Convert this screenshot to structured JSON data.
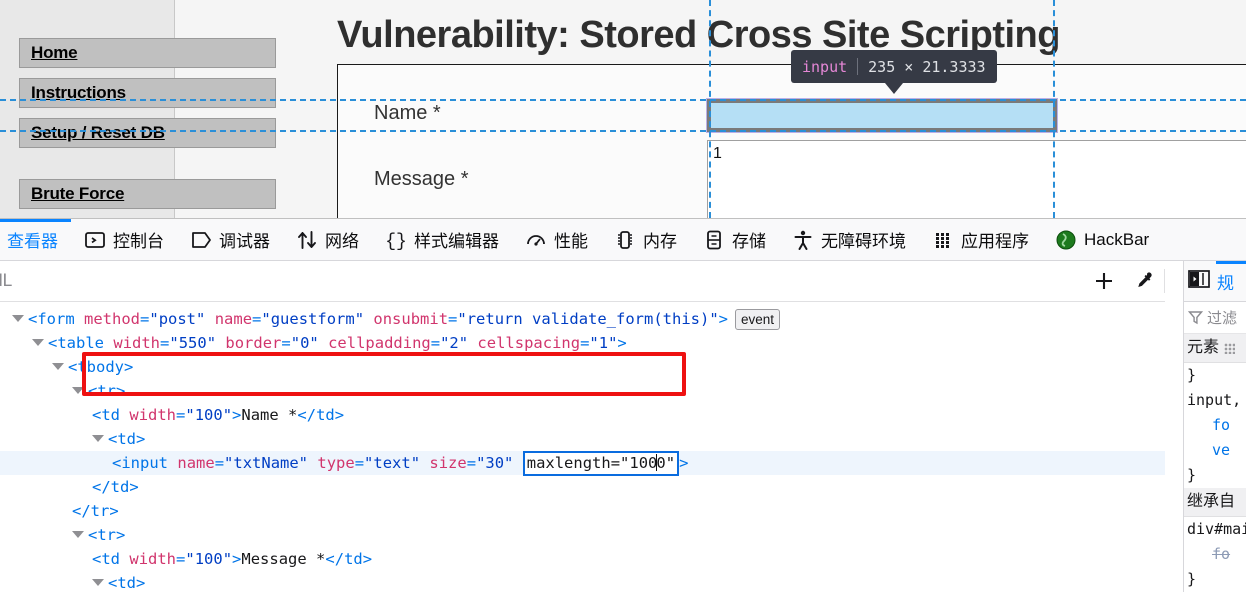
{
  "page": {
    "title": "Vulnerability: Stored Cross Site Scripting",
    "nav": [
      {
        "label": "Home"
      },
      {
        "label": "Instructions"
      },
      {
        "label": "Setup / Reset DB"
      },
      {
        "label": "Brute Force"
      }
    ],
    "form": {
      "name_label": "Name *",
      "name_value": "",
      "message_label": "Message *",
      "message_value": "1"
    },
    "inspector_tooltip": {
      "tag": "input",
      "dimensions": "235 × 21.3333"
    },
    "colors": {
      "highlight_fill": "#b5dff5",
      "guide_line": "#2a8fd8",
      "tooltip_bg": "#363a45",
      "accent": "#0a84ff",
      "red_annotation": "#ee1111"
    }
  },
  "devtools": {
    "tabs": [
      {
        "label": "查看器",
        "icon": "inspector-icon",
        "active": true
      },
      {
        "label": "控制台",
        "icon": "console-icon",
        "active": false
      },
      {
        "label": "调试器",
        "icon": "debugger-icon",
        "active": false
      },
      {
        "label": "网络",
        "icon": "network-icon",
        "active": false
      },
      {
        "label": "样式编辑器",
        "icon": "style-editor-icon",
        "active": false
      },
      {
        "label": "性能",
        "icon": "performance-icon",
        "active": false
      },
      {
        "label": "内存",
        "icon": "memory-icon",
        "active": false
      },
      {
        "label": "存储",
        "icon": "storage-icon",
        "active": false
      },
      {
        "label": "无障碍环境",
        "icon": "accessibility-icon",
        "active": false
      },
      {
        "label": "应用程序",
        "icon": "application-icon",
        "active": false
      },
      {
        "label": "HackBar",
        "icon": "hackbar-icon",
        "active": false
      }
    ],
    "subbar": {
      "breadcrumb": "ML",
      "add_node_icon": "plus-icon",
      "eyedropper_icon": "eyedropper-icon"
    },
    "markup": {
      "lines": [
        {
          "indent": 0,
          "twisty": true,
          "selected": false,
          "badge": "event",
          "tokens": [
            {
              "t": "punct",
              "s": "<"
            },
            {
              "t": "tag",
              "s": "form"
            },
            {
              "t": "txt",
              "s": " "
            },
            {
              "t": "attr",
              "s": "method"
            },
            {
              "t": "punct",
              "s": "="
            },
            {
              "t": "val",
              "s": "\"post\""
            },
            {
              "t": "txt",
              "s": " "
            },
            {
              "t": "attr",
              "s": "name"
            },
            {
              "t": "punct",
              "s": "="
            },
            {
              "t": "val",
              "s": "\"guestform\""
            },
            {
              "t": "txt",
              "s": " "
            },
            {
              "t": "attr",
              "s": "onsubmit"
            },
            {
              "t": "punct",
              "s": "="
            },
            {
              "t": "val",
              "s": "\"return validate_form(this)\""
            },
            {
              "t": "punct",
              "s": ">"
            }
          ]
        },
        {
          "indent": 1,
          "twisty": true,
          "selected": false,
          "badge": null,
          "tokens": [
            {
              "t": "punct",
              "s": "<"
            },
            {
              "t": "tag",
              "s": "table"
            },
            {
              "t": "txt",
              "s": " "
            },
            {
              "t": "attr",
              "s": "width"
            },
            {
              "t": "punct",
              "s": "="
            },
            {
              "t": "val",
              "s": "\"550\""
            },
            {
              "t": "txt",
              "s": " "
            },
            {
              "t": "attr",
              "s": "border"
            },
            {
              "t": "punct",
              "s": "="
            },
            {
              "t": "val",
              "s": "\"0\""
            },
            {
              "t": "txt",
              "s": " "
            },
            {
              "t": "attr",
              "s": "cellpadding"
            },
            {
              "t": "punct",
              "s": "="
            },
            {
              "t": "val",
              "s": "\"2\""
            },
            {
              "t": "txt",
              "s": " "
            },
            {
              "t": "attr",
              "s": "cellspacing"
            },
            {
              "t": "punct",
              "s": "="
            },
            {
              "t": "val",
              "s": "\"1\""
            },
            {
              "t": "punct",
              "s": ">"
            }
          ]
        },
        {
          "indent": 2,
          "twisty": true,
          "selected": false,
          "badge": null,
          "tokens": [
            {
              "t": "punct",
              "s": "<"
            },
            {
              "t": "tag",
              "s": "tbody"
            },
            {
              "t": "punct",
              "s": ">"
            }
          ]
        },
        {
          "indent": 3,
          "twisty": true,
          "selected": false,
          "badge": null,
          "tokens": [
            {
              "t": "punct",
              "s": "<"
            },
            {
              "t": "tag",
              "s": "tr"
            },
            {
              "t": "punct",
              "s": ">"
            }
          ]
        },
        {
          "indent": 4,
          "twisty": false,
          "selected": false,
          "badge": null,
          "tokens": [
            {
              "t": "punct",
              "s": "<"
            },
            {
              "t": "tag",
              "s": "td"
            },
            {
              "t": "txt",
              "s": " "
            },
            {
              "t": "attr",
              "s": "width"
            },
            {
              "t": "punct",
              "s": "="
            },
            {
              "t": "val",
              "s": "\"100\""
            },
            {
              "t": "punct",
              "s": ">"
            },
            {
              "t": "txt",
              "s": "Name *"
            },
            {
              "t": "punct",
              "s": "</"
            },
            {
              "t": "tag",
              "s": "td"
            },
            {
              "t": "punct",
              "s": ">"
            }
          ]
        },
        {
          "indent": 4,
          "twisty": true,
          "selected": false,
          "badge": null,
          "tokens": [
            {
              "t": "punct",
              "s": "<"
            },
            {
              "t": "tag",
              "s": "td"
            },
            {
              "t": "punct",
              "s": ">"
            }
          ]
        },
        {
          "indent": 5,
          "twisty": false,
          "selected": true,
          "badge": null,
          "edit_attr": {
            "text": "maxlength=\"100",
            "caret": true,
            "tail": "0\""
          },
          "tokens": [
            {
              "t": "punct",
              "s": "<"
            },
            {
              "t": "tag",
              "s": "input"
            },
            {
              "t": "txt",
              "s": " "
            },
            {
              "t": "attr",
              "s": "name"
            },
            {
              "t": "punct",
              "s": "="
            },
            {
              "t": "val",
              "s": "\"txtName\""
            },
            {
              "t": "txt",
              "s": " "
            },
            {
              "t": "attr",
              "s": "type"
            },
            {
              "t": "punct",
              "s": "="
            },
            {
              "t": "val",
              "s": "\"text\""
            },
            {
              "t": "txt",
              "s": " "
            },
            {
              "t": "attr",
              "s": "size"
            },
            {
              "t": "punct",
              "s": "="
            },
            {
              "t": "val",
              "s": "\"30\""
            },
            {
              "t": "txt",
              "s": " "
            }
          ],
          "tokens_after": [
            {
              "t": "punct",
              "s": ">"
            }
          ]
        },
        {
          "indent": 4,
          "twisty": false,
          "selected": false,
          "badge": null,
          "tokens": [
            {
              "t": "punct",
              "s": "</"
            },
            {
              "t": "tag",
              "s": "td"
            },
            {
              "t": "punct",
              "s": ">"
            }
          ]
        },
        {
          "indent": 3,
          "twisty": false,
          "selected": false,
          "badge": null,
          "tokens": [
            {
              "t": "punct",
              "s": "</"
            },
            {
              "t": "tag",
              "s": "tr"
            },
            {
              "t": "punct",
              "s": ">"
            }
          ]
        },
        {
          "indent": 3,
          "twisty": true,
          "selected": false,
          "badge": null,
          "tokens": [
            {
              "t": "punct",
              "s": "<"
            },
            {
              "t": "tag",
              "s": "tr"
            },
            {
              "t": "punct",
              "s": ">"
            }
          ]
        },
        {
          "indent": 4,
          "twisty": false,
          "selected": false,
          "badge": null,
          "tokens": [
            {
              "t": "punct",
              "s": "<"
            },
            {
              "t": "tag",
              "s": "td"
            },
            {
              "t": "txt",
              "s": " "
            },
            {
              "t": "attr",
              "s": "width"
            },
            {
              "t": "punct",
              "s": "="
            },
            {
              "t": "val",
              "s": "\"100\""
            },
            {
              "t": "punct",
              "s": ">"
            },
            {
              "t": "txt",
              "s": "Message *"
            },
            {
              "t": "punct",
              "s": "</"
            },
            {
              "t": "tag",
              "s": "td"
            },
            {
              "t": "punct",
              "s": ">"
            }
          ]
        },
        {
          "indent": 4,
          "twisty": true,
          "selected": false,
          "badge": null,
          "tokens": [
            {
              "t": "punct",
              "s": "<"
            },
            {
              "t": "tag",
              "s": "td"
            },
            {
              "t": "punct",
              "s": ">"
            }
          ]
        }
      ]
    },
    "css_sidebar": {
      "tab_label": "规",
      "layout_icon": "panel-layout-icon",
      "filter_placeholder": "过滤",
      "filter_icon": "filter-icon",
      "rules": [
        {
          "kind": "head",
          "text": "元素"
        },
        {
          "kind": "close",
          "text": "}"
        },
        {
          "kind": "sel",
          "text": "input,"
        },
        {
          "kind": "prop",
          "text": "fo",
          "struck": false
        },
        {
          "kind": "prop",
          "text": "ve",
          "struck": false
        },
        {
          "kind": "close",
          "text": "}"
        },
        {
          "kind": "head",
          "text": "继承自"
        },
        {
          "kind": "sel",
          "text": "div#mai"
        },
        {
          "kind": "prop",
          "text": "fo",
          "struck": true
        },
        {
          "kind": "close",
          "text": "}"
        }
      ]
    }
  }
}
